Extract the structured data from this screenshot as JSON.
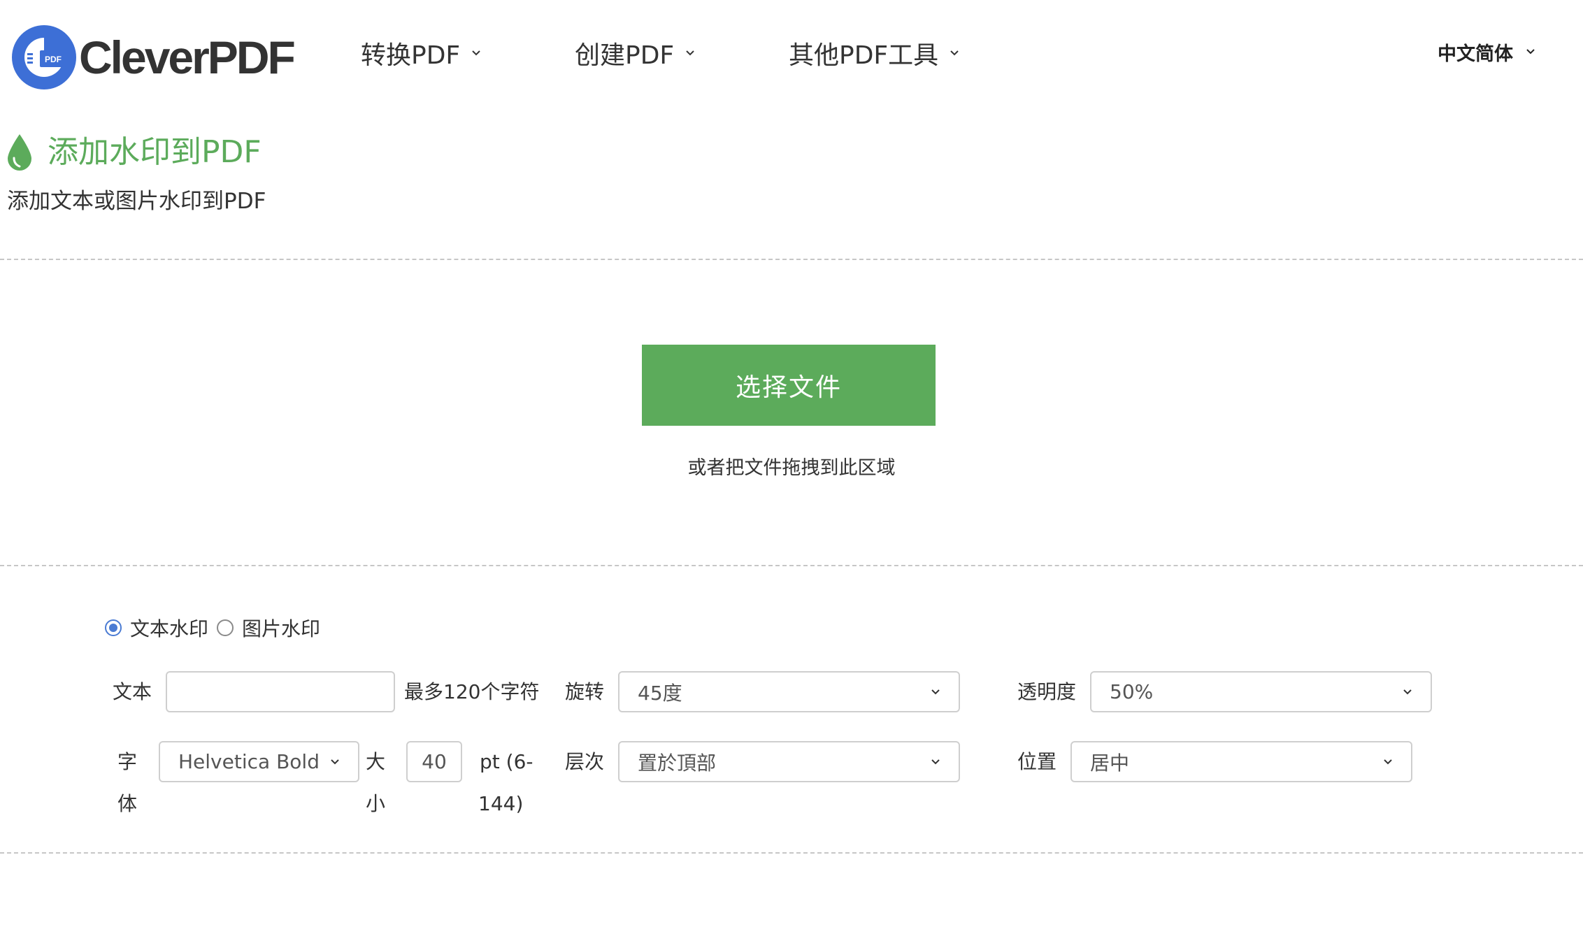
{
  "header": {
    "logo_text": "CleverPDF",
    "logo_badge_text": "PDF",
    "nav": [
      {
        "label": "转换PDF"
      },
      {
        "label": "创建PDF"
      },
      {
        "label": "其他PDF工具"
      }
    ],
    "language": "中文简体"
  },
  "tool": {
    "title": "添加水印到PDF",
    "subtitle": "添加文本或图片水印到PDF"
  },
  "upload": {
    "choose_button": "选择文件",
    "drop_hint": "或者把文件拖拽到此区域"
  },
  "options": {
    "watermark_type": {
      "text_label": "文本水印",
      "image_label": "图片水印",
      "selected": "text"
    },
    "text": {
      "label": "文本",
      "value": "",
      "hint": "最多120个字符"
    },
    "rotation": {
      "label": "旋转",
      "value": "45度"
    },
    "opacity": {
      "label": "透明度",
      "value": "50%"
    },
    "font": {
      "label_1": "字",
      "label_2": "体",
      "value": "Helvetica Bold"
    },
    "size": {
      "label_1": "大",
      "label_2": "小",
      "value": "40",
      "hint_1": "pt (6-",
      "hint_2": "144)"
    },
    "layer": {
      "label": "层次",
      "value": "置於頂部"
    },
    "position": {
      "label": "位置",
      "value": "居中"
    }
  },
  "colors": {
    "accent_green": "#5cab5b",
    "logo_blue": "#3d6fd6",
    "radio_blue": "#4a7bd3"
  }
}
